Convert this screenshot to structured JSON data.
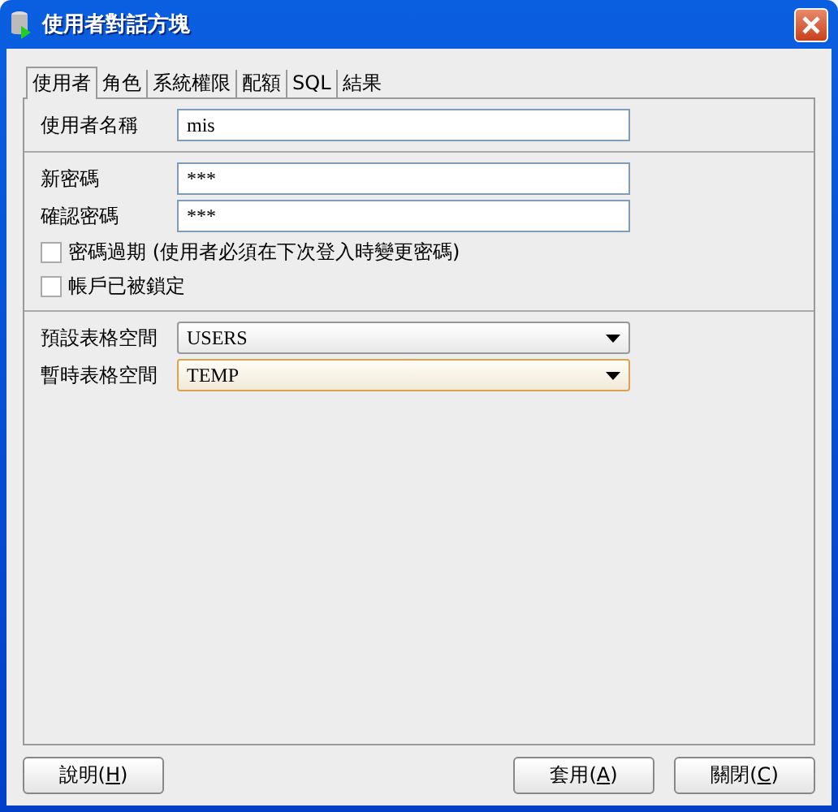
{
  "window": {
    "title": "使用者對話方塊"
  },
  "tabs": [
    {
      "label": "使用者",
      "selected": true
    },
    {
      "label": "角色",
      "selected": false
    },
    {
      "label": "系統權限",
      "selected": false
    },
    {
      "label": "配額",
      "selected": false
    },
    {
      "label": "SQL",
      "selected": false
    },
    {
      "label": "結果",
      "selected": false
    }
  ],
  "sections": [
    {
      "rows": [
        {
          "kind": "text",
          "label": "使用者名稱",
          "value": "mis"
        }
      ]
    },
    {
      "rows": [
        {
          "kind": "text",
          "label": "新密碼",
          "value": "***"
        },
        {
          "kind": "text",
          "label": "確認密碼",
          "value": "***"
        },
        {
          "kind": "checkbox",
          "label": "密碼過期 (使用者必須在下次登入時變更密碼)",
          "checked": false
        },
        {
          "kind": "checkbox",
          "label": "帳戶已被鎖定",
          "checked": false
        }
      ]
    },
    {
      "rows": [
        {
          "kind": "combo",
          "label": "預設表格空間",
          "value": "USERS",
          "focused": false
        },
        {
          "kind": "combo",
          "label": "暫時表格空間",
          "value": "TEMP",
          "focused": true
        }
      ]
    }
  ],
  "buttons_left": [
    {
      "label": "說明(H)"
    }
  ],
  "buttons_right": [
    {
      "label": "套用(A)"
    },
    {
      "label": "關閉(C)"
    }
  ]
}
